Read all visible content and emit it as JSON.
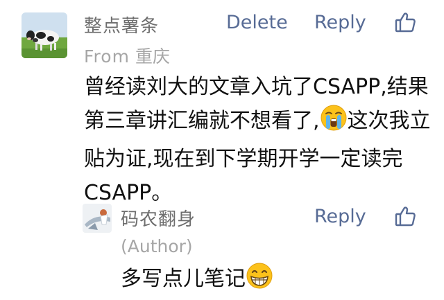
{
  "comment": {
    "nickname": "整点薯条",
    "from_label": "From",
    "location": "重庆",
    "delete_label": "Delete",
    "reply_label": "Reply",
    "text_part1": "曾经读刘大的文章入坑了CSAPP,结果第三章讲汇编就不想看了,",
    "emoji": "crying-face",
    "text_part2": "这次我立贴为证,现在到下学期开学一定读完CSAPP。"
  },
  "reply": {
    "nickname": "码农翻身",
    "author_label": "(Author)",
    "reply_label": "Reply",
    "text": "多写点儿笔记",
    "emoji": "grinning-face"
  },
  "colors": {
    "link": "#576b95",
    "nickname": "#6e6e6e",
    "meta": "#a6a6a6",
    "text": "#111111"
  }
}
